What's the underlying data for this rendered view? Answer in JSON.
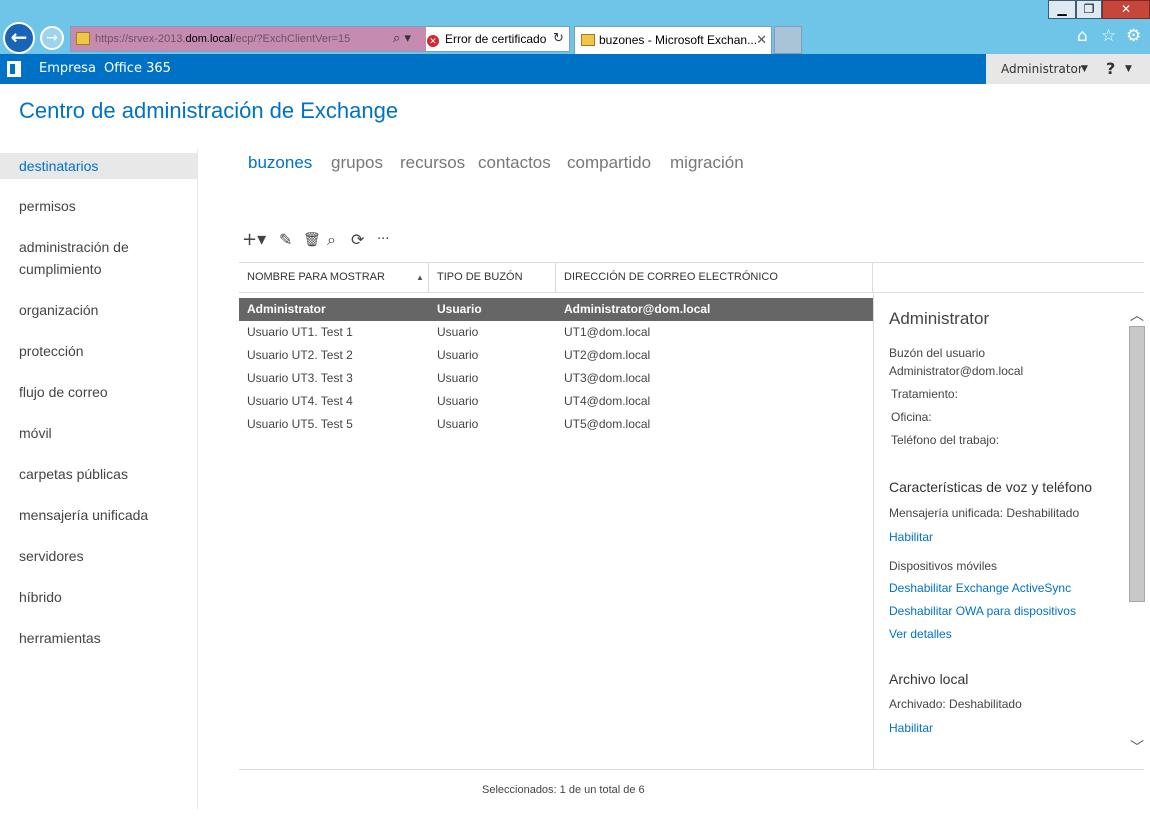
{
  "browser": {
    "window_controls": {
      "minimize": "▁",
      "maximize": "❐",
      "close": "✕"
    },
    "back_icon": "arrow-left-icon",
    "forward_icon": "arrow-right-icon",
    "url": {
      "prefix": "https://srvex-2013.",
      "host": "dom.local",
      "path": "/ecp/?ExchClientVer=15"
    },
    "search_icon": "⌕ ▾",
    "cert_error": "Error de certificado",
    "refresh_icon": "↻",
    "tab_title": "buzones - Microsoft Exchan...",
    "tab_close": "✕",
    "tools": {
      "home": "⌂",
      "favorites": "☆",
      "settings": "⚙"
    }
  },
  "topbar": {
    "empresa": "Empresa",
    "office365": "Office 365",
    "user": "Administrator",
    "user_caret": "▼",
    "help": "?",
    "help_caret": "▼",
    "color": "#0072c6"
  },
  "app_title": "Centro de administración de Exchange",
  "left_nav": [
    {
      "label": "destinatarios",
      "active": true
    },
    {
      "label": "permisos"
    },
    {
      "label": "administración de"
    },
    {
      "label": "cumplimiento"
    },
    {
      "label": "organización"
    },
    {
      "label": "protección"
    },
    {
      "label": "flujo de correo"
    },
    {
      "label": "móvil"
    },
    {
      "label": "carpetas públicas"
    },
    {
      "label": "mensajería unificada"
    },
    {
      "label": "servidores"
    },
    {
      "label": "híbrido"
    },
    {
      "label": "herramientas"
    }
  ],
  "sub_tabs": [
    "buzones",
    "grupos",
    "recursos",
    "contactos",
    "compartido",
    "migración"
  ],
  "toolbar": {
    "add": "+▾",
    "edit": "✎",
    "delete": "🗑",
    "search": "⌕",
    "refresh": "⟳",
    "more": "···"
  },
  "table": {
    "columns": [
      "NOMBRE PARA MOSTRAR",
      "TIPO DE BUZÓN",
      "DIRECCIÓN DE CORREO ELECTRÓNICO"
    ],
    "sort_arrow": "▲",
    "rows": [
      {
        "name": "Administrator",
        "type": "Usuario",
        "email": "Administrator@dom.local",
        "selected": true
      },
      {
        "name": "Usuario UT1. Test 1",
        "type": "Usuario",
        "email": "UT1@dom.local"
      },
      {
        "name": "Usuario UT2. Test 2",
        "type": "Usuario",
        "email": "UT2@dom.local"
      },
      {
        "name": "Usuario UT3. Test 3",
        "type": "Usuario",
        "email": "UT3@dom.local"
      },
      {
        "name": "Usuario UT4. Test 4",
        "type": "Usuario",
        "email": "UT4@dom.local"
      },
      {
        "name": "Usuario UT5. Test 5",
        "type": "Usuario",
        "email": "UT5@dom.local"
      }
    ]
  },
  "status": "Seleccionados: 1 de un total de 6",
  "details": {
    "title": "Administrator",
    "mailbox_type": "Buzón del usuario",
    "email": "Administrator@dom.local",
    "tratamiento": "Tratamiento:",
    "oficina": "Oficina:",
    "telefono": "Teléfono del trabajo:",
    "voice_title": "Características de voz y teléfono",
    "um_status": "Mensajería unificada:  Deshabilitado",
    "um_enable": "Habilitar",
    "mobile_title": "Dispositivos móviles",
    "disable_activesync": "Deshabilitar Exchange ActiveSync",
    "disable_owa": "Deshabilitar OWA para dispositivos",
    "view_details": "Ver detalles",
    "archive_title": "Archivo local",
    "archive_status": "Archivado:  Deshabilitado",
    "archive_enable": "Habilitar",
    "scroll_up": "︿",
    "scroll_down": "﹀"
  }
}
